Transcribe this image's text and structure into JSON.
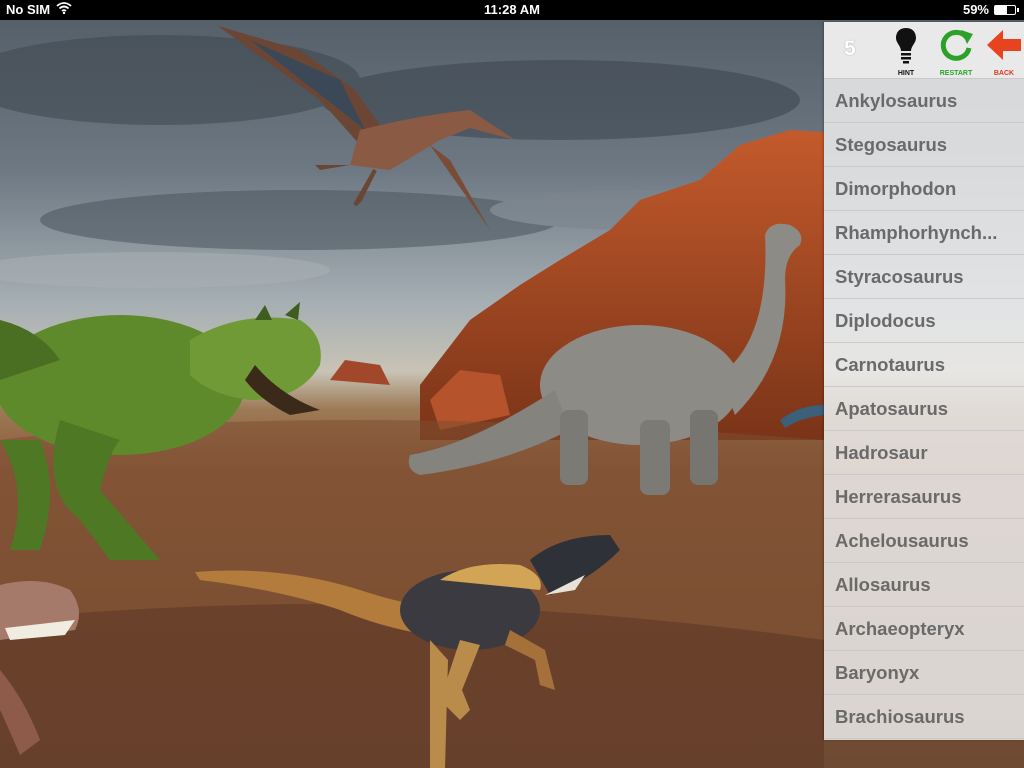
{
  "status_bar": {
    "carrier": "No SIM",
    "time": "11:28 AM",
    "battery_percent": "59%",
    "battery_level": 0.59
  },
  "toolbar": {
    "counter": "5",
    "hint_label": "HINT",
    "restart_label": "RESTART",
    "back_label": "BACK"
  },
  "dino_names": [
    "Ankylosaurus",
    "Stegosaurus",
    "Dimorphodon",
    "Rhamphorhynch...",
    "Styracosaurus",
    "Diplodocus",
    "Carnotaurus",
    "Apatosaurus",
    "Hadrosaur",
    "Herrerasaurus",
    "Achelousaurus",
    "Allosaurus",
    "Archaeopteryx",
    "Baryonyx",
    "Brachiosaurus"
  ],
  "scene": {
    "creatures": [
      "dimorphodon-creature",
      "carnotaurus-creature",
      "apatosaurus-creature",
      "herrerasaurus-creature",
      "partial-predator-creature"
    ]
  },
  "colors": {
    "restart": "#2aa229",
    "back": "#d93c1f",
    "list_text": "#6a6a6a"
  }
}
